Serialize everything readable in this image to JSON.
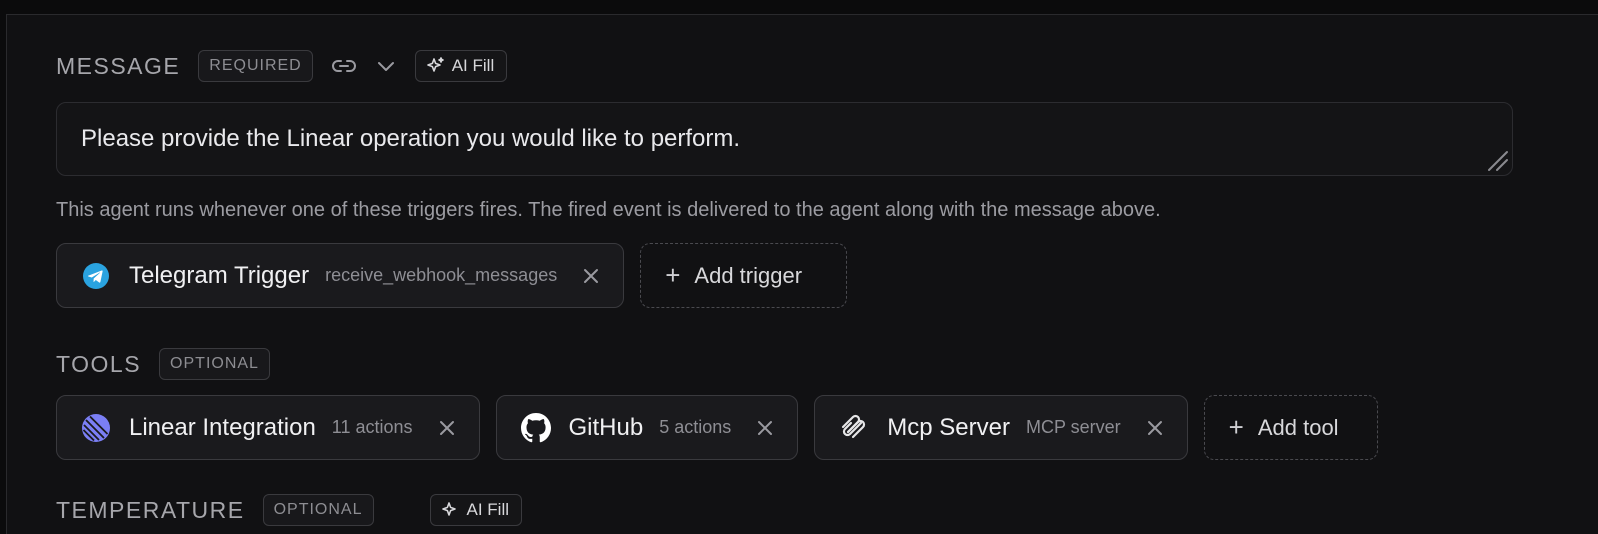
{
  "message_section": {
    "label": "MESSAGE",
    "badge": "REQUIRED",
    "ai_fill_label": "AI Fill",
    "icons": [
      "link-icon",
      "chevron-down-icon",
      "sparkle-icon"
    ],
    "value": "Please provide the Linear operation you would like to perform."
  },
  "triggers": {
    "helper_text": "This agent runs whenever one of these triggers fires. The fired event is delivered to the agent along with the message above.",
    "items": [
      {
        "title": "Telegram Trigger",
        "subtitle": "receive_webhook_messages",
        "icon": "telegram-icon"
      }
    ],
    "add_label": "Add trigger"
  },
  "tools_section": {
    "label": "TOOLS",
    "badge": "OPTIONAL",
    "items": [
      {
        "title": "Linear Integration",
        "subtitle": "11 actions",
        "icon": "linear-icon"
      },
      {
        "title": "GitHub",
        "subtitle": "5 actions",
        "icon": "github-icon"
      },
      {
        "title": "Mcp Server",
        "subtitle": "MCP server",
        "icon": "mcp-icon"
      }
    ],
    "add_label": "Add tool"
  },
  "temperature_section": {
    "label": "TEMPERATURE",
    "badge": "OPTIONAL",
    "ai_fill_label": "AI Fill"
  },
  "colors": {
    "background": "#111113",
    "chip_bg": "#1a1a1d",
    "telegram_blue": "#2aa3e0",
    "linear_purple": "#7b7ff5"
  }
}
